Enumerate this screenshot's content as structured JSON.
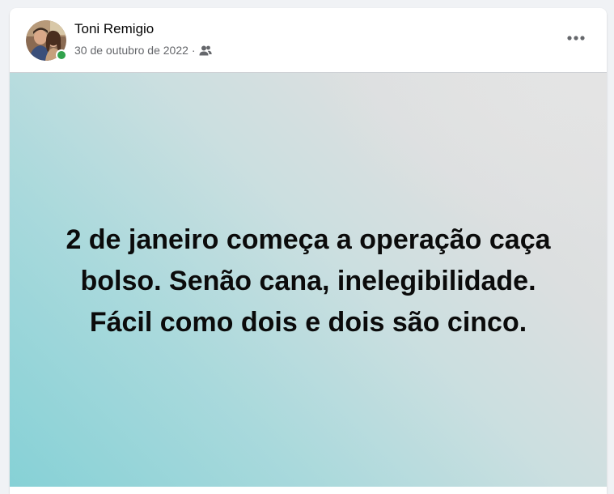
{
  "post": {
    "author": "Toni Remigio",
    "date": "30 de outubro de 2022",
    "separator": "·",
    "audience_icon": "friends-icon",
    "more_icon": "more-horizontal-icon",
    "presence_color": "#31a24c",
    "background_style": "teal-to-gray gradient",
    "text_lines": [
      "2 de janeiro começa a operação caça",
      "bolso. Senão cana, inelegibilidade.",
      "Fácil como dois e dois são cinco."
    ]
  }
}
